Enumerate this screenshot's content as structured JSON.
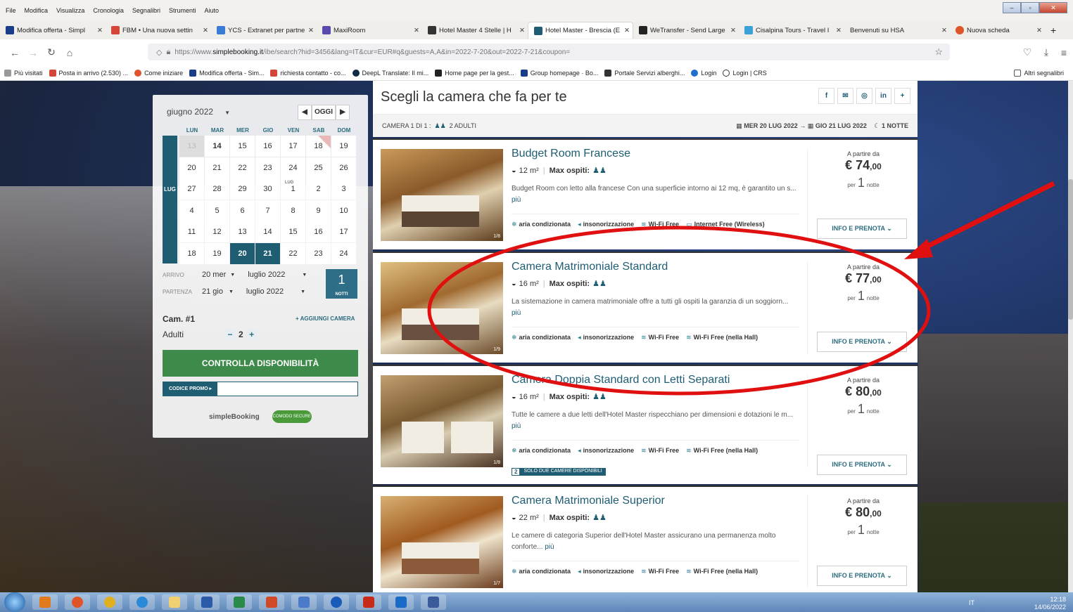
{
  "browser": {
    "menu": [
      "File",
      "Modifica",
      "Visualizza",
      "Cronologia",
      "Segnalibri",
      "Strumenti",
      "Aiuto"
    ],
    "tabs": [
      {
        "label": "Modifica offerta - Simpl",
        "icon_color": "#1a3d8a"
      },
      {
        "label": "FBM • Una nuova settin",
        "icon_color": "#d44638"
      },
      {
        "label": "YCS - Extranet per partne",
        "icon_color": "#3a7bd5"
      },
      {
        "label": "MaxiRoom",
        "icon_color": "#5a4ab0"
      },
      {
        "label": "Hotel Master 4 Stelle | H",
        "icon_color": "#333333"
      },
      {
        "label": "Hotel Master - Brescia (E",
        "icon_color": "#1f5d73"
      },
      {
        "label": "WeTransfer - Send Large",
        "icon_color": "#222222"
      },
      {
        "label": "Cisalpina Tours - Travel I",
        "icon_color": "#3aa0d5"
      },
      {
        "label": "Benvenuti su HSA",
        "icon_color": "#ffffff"
      },
      {
        "label": "Nuova scheda",
        "icon_color": "#e0542a"
      }
    ],
    "url_pre": "https://www.",
    "url_domain": "simplebooking.it",
    "url_post": "/ibe/search?hid=3456&lang=IT&cur=EUR#q&guests=A,A&in=2022-7-20&out=2022-7-21&coupon=",
    "bookmarks": [
      "Più visitati",
      "Posta in arrivo (2.530) ...",
      "Come iniziare",
      "Modifica offerta - Sim...",
      "richiesta contatto - co...",
      "DeepL Translate: Il mi...",
      "Home page per la gest...",
      "Group homepage · Bo...",
      "Portale Servizi alberghi...",
      "Login",
      "Login | CRS"
    ],
    "other_bookmarks": "Altri segnalibri"
  },
  "calendar": {
    "month_label": "giugno 2022",
    "today": "OGGI",
    "days": [
      "LUN",
      "MAR",
      "MER",
      "GIO",
      "VEN",
      "SAB",
      "DOM"
    ],
    "month_tag": "LUG",
    "rows": [
      [
        "13",
        "14",
        "15",
        "16",
        "17",
        "18",
        "19"
      ],
      [
        "20",
        "21",
        "22",
        "23",
        "24",
        "25",
        "26"
      ],
      [
        "27",
        "28",
        "29",
        "30",
        "1",
        "2",
        "3"
      ],
      [
        "4",
        "5",
        "6",
        "7",
        "8",
        "9",
        "10"
      ],
      [
        "11",
        "12",
        "13",
        "14",
        "15",
        "16",
        "17"
      ],
      [
        "18",
        "19",
        "20",
        "21",
        "22",
        "23",
        "24"
      ]
    ],
    "lug_marker": "LUG"
  },
  "form": {
    "arrivo_label": "ARRIVO",
    "arrivo_day": "20 mer",
    "arrivo_month": "luglio 2022",
    "partenza_label": "PARTENZA",
    "partenza_day": "21 gio",
    "partenza_month": "luglio 2022",
    "nights": "1",
    "nights_label": "NOTTI",
    "cam": "Cam. #1",
    "add_room": "+ AGGIUNGI CAMERA",
    "adults_label": "Adulti",
    "adults": "2",
    "check": "CONTROLLA DISPONIBILITÀ",
    "promo": "CODICE PROMO ▸",
    "brand": "simpleBooking",
    "secure": "COMODO SECURE"
  },
  "results": {
    "title": "Scegli la camera che fa per te",
    "share": [
      "f",
      "✉",
      "◎",
      "in",
      "+"
    ],
    "camera": "CAMERA 1 DI 1 :",
    "adults": "2 ADULTI",
    "checkin": "MER 20 LUG 2022",
    "checkout": "GIO 21 LUG 2022",
    "nights": "1 NOTTE",
    "rooms": [
      {
        "name": "Budget Room Francese",
        "size": "12 m²",
        "max": "Max ospiti:",
        "desc": "Budget Room con letto alla francese Con una superficie intorno ai 12 mq, è garantito un s...",
        "more": "più",
        "amenities": [
          "aria condizionata",
          "insonorizzazione",
          "Wi-Fi Free",
          "Internet Free (Wireless)"
        ],
        "from": "A partire da",
        "price": "€ 74",
        "cents": ",00",
        "per": "per",
        "n": "1",
        "notte": "notte",
        "btn": "INFO E PRENOTA",
        "photos": "1/8"
      },
      {
        "name": "Camera Matrimoniale Standard",
        "size": "16 m²",
        "max": "Max ospiti:",
        "desc": "La sistemazione in camera matrimoniale offre a tutti gli ospiti la garanzia di un soggiorn...",
        "more": "più",
        "amenities": [
          "aria condizionata",
          "insonorizzazione",
          "Wi-Fi Free",
          "Wi-Fi Free (nella Hall)"
        ],
        "from": "A partire da",
        "price": "€ 77",
        "cents": ",00",
        "per": "per",
        "n": "1",
        "notte": "notte",
        "btn": "INFO E PRENOTA",
        "photos": "1/9"
      },
      {
        "name": "Camera Doppia Standard con Letti Separati",
        "size": "16 m²",
        "max": "Max ospiti:",
        "desc": "Tutte le camere a due letti dell'Hotel Master rispecchiano per dimensioni e dotazioni le m...",
        "more": "più",
        "amenities": [
          "aria condizionata",
          "insonorizzazione",
          "Wi-Fi Free",
          "Wi-Fi Free (nella Hall)"
        ],
        "from": "A partire da",
        "price": "€ 80",
        "cents": ",00",
        "per": "per",
        "n": "1",
        "notte": "notte",
        "btn": "INFO E PRENOTA",
        "photos": "1/8",
        "badge_n": "2",
        "badge": "SOLO DUE CAMERE DISPONIBILI"
      },
      {
        "name": "Camera Matrimoniale Superior",
        "size": "22 m²",
        "max": "Max ospiti:",
        "desc": "Le camere di categoria Superior dell'Hotel Master assicurano una permanenza molto conforte...",
        "more": "più",
        "amenities": [
          "aria condizionata",
          "insonorizzazione",
          "Wi-Fi Free",
          "Wi-Fi Free (nella Hall)"
        ],
        "from": "A partire da",
        "price": "€ 80",
        "cents": ",00",
        "per": "per",
        "n": "1",
        "notte": "notte",
        "btn": "INFO E PRENOTA",
        "photos": "1/7"
      }
    ]
  },
  "taskbar": {
    "lang": "IT",
    "time": "12:18",
    "date": "14/06/2022"
  },
  "colors": {
    "accent": "#1f5d73",
    "check": "#3e8a4a",
    "annotation": "#e01010"
  }
}
